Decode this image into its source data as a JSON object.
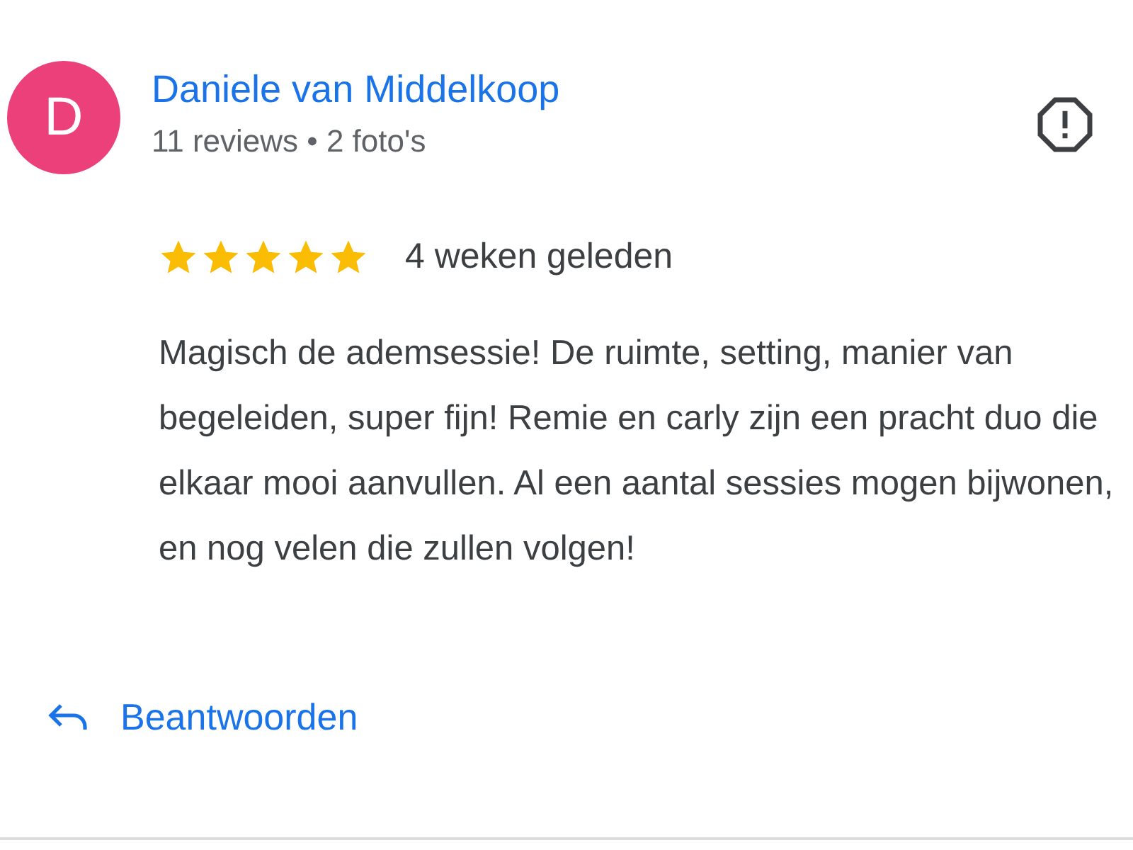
{
  "review": {
    "avatar": {
      "letter": "D",
      "color": "#ec407a"
    },
    "author": "Daniele van Middelkoop",
    "meta": "11 reviews • 2 foto's",
    "stars": 5,
    "time": "4 weken geleden",
    "text": "Magisch de ademsessie! De ruimte, setting, manier van begeleiden, super fijn! Remie en carly zijn een pracht duo die elkaar mooi aanvullen. Al een aantal sessies mogen bijwonen, en nog velen die zullen volgen!",
    "reply_button": "Beantwoorden"
  }
}
